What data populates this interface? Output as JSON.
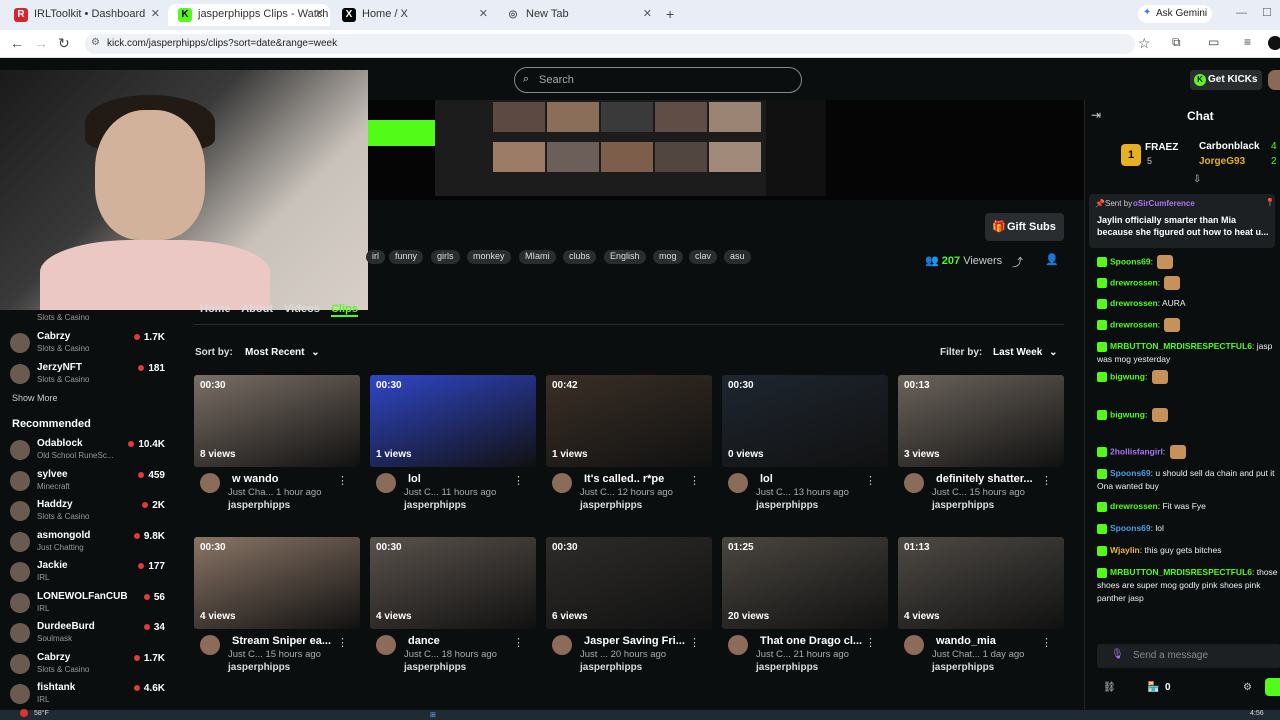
{
  "browser": {
    "tabs": [
      {
        "title": "IRLToolkit • Dashboard",
        "icon": "R"
      },
      {
        "title": "jasperphipps Clips - Watch Live",
        "icon": "K"
      },
      {
        "title": "Home / X",
        "icon": "X"
      },
      {
        "title": "New Tab",
        "icon": "◎"
      }
    ],
    "ask_gemini": "Ask Gemini",
    "url": "kick.com/jasperphipps/clips?sort=date&range=week"
  },
  "header": {
    "search_placeholder": "Search",
    "get_kicks": "Get KICKs"
  },
  "stream": {
    "tags": [
      "irl",
      "funny",
      "girls",
      "monkey",
      "MIami",
      "clubs",
      "English",
      "mog",
      "clav",
      "asu"
    ],
    "viewers": "207",
    "viewers_label": "Viewers",
    "gift_subs": "Gift Subs",
    "nav_tabs": [
      "Home",
      "About",
      "Videos",
      "Clips"
    ]
  },
  "clips_controls": {
    "sort_label": "Sort by:",
    "sort_value": "Most Recent",
    "filter_label": "Filter by:",
    "filter_value": "Last Week"
  },
  "clips": [
    {
      "duration": "00:30",
      "views": "8 views",
      "title": "w wando",
      "meta": "Just Cha... 1 hour ago",
      "author": "jasperphipps",
      "color": "#7b6f66"
    },
    {
      "duration": "00:30",
      "views": "1 views",
      "title": "lol",
      "meta": "Just C... 11 hours ago",
      "author": "jasperphipps",
      "color": "#3046c8"
    },
    {
      "duration": "00:42",
      "views": "1 views",
      "title": "It's called.. r*pe",
      "meta": "Just C... 12 hours ago",
      "author": "jasperphipps",
      "color": "#3a2f26"
    },
    {
      "duration": "00:30",
      "views": "0 views",
      "title": "lol",
      "meta": "Just C... 13 hours ago",
      "author": "jasperphipps",
      "color": "#1e2630"
    },
    {
      "duration": "00:13",
      "views": "3 views",
      "title": "definitely shatter...",
      "meta": "Just C... 15 hours ago",
      "author": "jasperphipps",
      "color": "#6c645c"
    },
    {
      "duration": "00:30",
      "views": "4 views",
      "title": "Stream Sniper ea...",
      "meta": "Just C... 15 hours ago",
      "author": "jasperphipps",
      "color": "#8a7566"
    },
    {
      "duration": "00:30",
      "views": "4 views",
      "title": "dance",
      "meta": "Just C... 18 hours ago",
      "author": "jasperphipps",
      "color": "#5a524c"
    },
    {
      "duration": "00:30",
      "views": "6 views",
      "title": "Jasper Saving Fri...",
      "meta": "Just ... 20 hours ago",
      "author": "jasperphipps",
      "color": "#2e2c2a"
    },
    {
      "duration": "01:25",
      "views": "20 views",
      "title": "That one Drago cl...",
      "meta": "Just C... 21 hours ago",
      "author": "jasperphipps",
      "color": "#4a4640"
    },
    {
      "duration": "01:13",
      "views": "4 views",
      "title": "wando_mia",
      "meta": "Just Chat... 1 day ago",
      "author": "jasperphipps",
      "color": "#4e4a45"
    }
  ],
  "leftnav": {
    "following": [
      {
        "name": "",
        "category": "Slots & Casino",
        "viewers": ""
      },
      {
        "name": "Cabrzy",
        "category": "Slots & Casino",
        "viewers": "1.7K"
      },
      {
        "name": "JerzyNFT",
        "category": "Slots & Casino",
        "viewers": "181"
      }
    ],
    "show_more": "Show More",
    "recommended_title": "Recommended",
    "recommended": [
      {
        "name": "Odablock",
        "category": "Old School RuneSc...",
        "viewers": "10.4K"
      },
      {
        "name": "sylvee",
        "category": "Minecraft",
        "viewers": "459"
      },
      {
        "name": "Haddzy",
        "category": "Slots & Casino",
        "viewers": "2K"
      },
      {
        "name": "asmongold",
        "category": "Just Chatting",
        "viewers": "9.8K"
      },
      {
        "name": "Jackie",
        "category": "IRL",
        "viewers": "177"
      },
      {
        "name": "LONEWOLFanCUB",
        "category": "IRL",
        "viewers": "56"
      },
      {
        "name": "DurdeeBurd",
        "category": "Soulmask",
        "viewers": "34"
      },
      {
        "name": "Cabrzy",
        "category": "Slots & Casino",
        "viewers": "1.7K"
      },
      {
        "name": "fishtank",
        "category": "IRL",
        "viewers": "4.6K"
      }
    ]
  },
  "chat": {
    "title": "Chat",
    "leaders": [
      {
        "rank": "1",
        "name": "FRAEZ",
        "count": "5"
      },
      {
        "name": "Carbonblack",
        "count": "4"
      },
      {
        "name": "JorgeG93",
        "count": "2"
      }
    ],
    "pinned_by_label": "Sent by",
    "pinned_by": "oSirCumference",
    "pinned_text": "Jaylin officially smarter than Mia because she figured out how to heat u...",
    "messages": [
      {
        "user": "Spoons69",
        "text": ""
      },
      {
        "user": "drewrossen",
        "text": ""
      },
      {
        "user": "drewrossen",
        "text": "AURA"
      },
      {
        "user": "drewrossen",
        "text": ""
      },
      {
        "user": "MRBUTTON_MRDISRESPECTFUL6",
        "text": "jasp was mog yesterday"
      },
      {
        "user": "bigwung",
        "text": ""
      },
      {
        "user": "bigwung",
        "text": ""
      },
      {
        "user": "2hollisfangirl",
        "text": ""
      },
      {
        "user": "Spoons69",
        "text": "u should sell da chain and put it Ona wanted buy"
      },
      {
        "user": "drewrossen",
        "text": "Fit was Fye"
      },
      {
        "user": "Spoons69",
        "text": "lol"
      },
      {
        "user": "Wjaylin",
        "text": "this guy gets bitches"
      },
      {
        "user": "MRBUTTON_MRDISRESPECTFUL6",
        "text": "those shoes are super mog godly pink shoes pink panther jasp"
      }
    ],
    "input_placeholder": "Send a message",
    "points": "0"
  },
  "taskbar": {
    "weather": "58°F",
    "time": "4:56"
  },
  "colors": {
    "kick_green": "#53fc18",
    "bg": "#0b0e0f"
  }
}
